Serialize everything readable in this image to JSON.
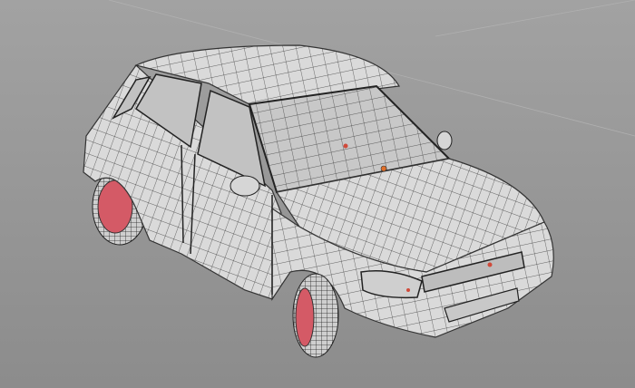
{
  "scene": {
    "background_top": "#a2a2a2",
    "background_bottom": "#8c8c8c",
    "body_color": "#dadada",
    "window_color": "#bdbdbd",
    "wireframe_color": "#3a3a3a",
    "rim_color": "#d45a66",
    "tire_color": "#cfcfcf",
    "marker_color": "#e0702a"
  }
}
